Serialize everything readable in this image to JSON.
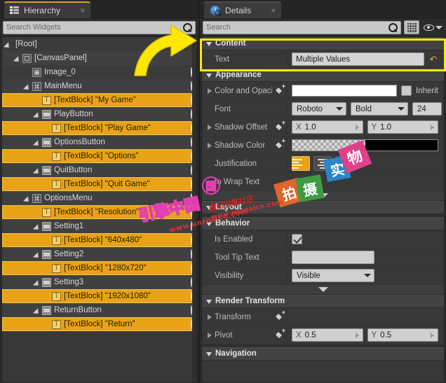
{
  "hierarchy_panel": {
    "tab": {
      "label": "Hierarchy",
      "icon": "list-icon",
      "close": "×"
    },
    "search": {
      "placeholder": "Search Widgets",
      "icon": "search-icon"
    },
    "tree": [
      {
        "label": "[Root]",
        "depth": 0,
        "icon": "none",
        "selected": false,
        "expander": "open",
        "eye": false
      },
      {
        "label": "[CanvasPanel]",
        "depth": 1,
        "icon": "panel",
        "selected": false,
        "expander": "open",
        "eye": false
      },
      {
        "label": "Image_0",
        "depth": 2,
        "icon": "image",
        "selected": false,
        "expander": "none",
        "eye": true
      },
      {
        "label": "MainMenu",
        "depth": 2,
        "icon": "vbox",
        "selected": false,
        "expander": "open",
        "eye": true
      },
      {
        "label": "[TextBlock] \"My Game\"",
        "depth": 3,
        "icon": "text",
        "selected": true,
        "expander": "none",
        "eye": true
      },
      {
        "label": "PlayButton",
        "depth": 3,
        "icon": "button",
        "selected": false,
        "expander": "open",
        "eye": true
      },
      {
        "label": "[TextBlock] \"Play Game\"",
        "depth": 4,
        "icon": "text",
        "selected": true,
        "expander": "none",
        "eye": true
      },
      {
        "label": "OptionsButton",
        "depth": 3,
        "icon": "button",
        "selected": false,
        "expander": "open",
        "eye": true
      },
      {
        "label": "[TextBlock] \"Options\"",
        "depth": 4,
        "icon": "text",
        "selected": true,
        "expander": "none",
        "eye": true
      },
      {
        "label": "QuitButton",
        "depth": 3,
        "icon": "button",
        "selected": false,
        "expander": "open",
        "eye": true
      },
      {
        "label": "[TextBlock] \"Quit Game\"",
        "depth": 4,
        "icon": "text",
        "selected": true,
        "expander": "none",
        "eye": true
      },
      {
        "label": "OptionsMenu",
        "depth": 2,
        "icon": "vbox",
        "selected": false,
        "expander": "open",
        "eye": true
      },
      {
        "label": "[TextBlock] \"Resolution\"",
        "depth": 3,
        "icon": "text",
        "selected": true,
        "expander": "none",
        "eye": true
      },
      {
        "label": "Setting1",
        "depth": 3,
        "icon": "button",
        "selected": false,
        "expander": "open",
        "eye": true
      },
      {
        "label": "[TextBlock] \"640x480\"",
        "depth": 4,
        "icon": "text",
        "selected": true,
        "expander": "none",
        "eye": true
      },
      {
        "label": "Setting2",
        "depth": 3,
        "icon": "button",
        "selected": false,
        "expander": "open",
        "eye": true
      },
      {
        "label": "[TextBlock] \"1280x720\"",
        "depth": 4,
        "icon": "text",
        "selected": true,
        "expander": "none",
        "eye": true
      },
      {
        "label": "Setting3",
        "depth": 3,
        "icon": "button",
        "selected": false,
        "expander": "open",
        "eye": true
      },
      {
        "label": "[TextBlock] \"1920x1080\"",
        "depth": 4,
        "icon": "text",
        "selected": true,
        "expander": "none",
        "eye": true
      },
      {
        "label": "ReturnButton",
        "depth": 3,
        "icon": "button",
        "selected": false,
        "expander": "open",
        "eye": true
      },
      {
        "label": "[TextBlock] \"Return\"",
        "depth": 4,
        "icon": "text",
        "selected": true,
        "expander": "none",
        "eye": true
      }
    ]
  },
  "details_panel": {
    "tab": {
      "label": "Details",
      "icon": "info-magnifier-icon",
      "close": "×"
    },
    "search": {
      "placeholder": "Search",
      "icon": "search-icon"
    },
    "toolbar": {
      "grid_icon": "grid-view-icon",
      "eye_icon": "eye-icon",
      "caret_icon": "chevron-down-icon"
    },
    "sections": {
      "content": {
        "title": "Content",
        "text_label": "Text",
        "text_value": "Multiple Values",
        "revert_icon": "revert-arrow-icon"
      },
      "appearance": {
        "title": "Appearance",
        "color_and_opacity_label": "Color and Opaci",
        "color_value_hex": "#ffffff",
        "inherit_label": "Inherit",
        "inherit_checked": false,
        "font_label": "Font",
        "font_family": "Roboto",
        "font_style": "Bold",
        "font_size": "24",
        "shadow_offset_label": "Shadow Offset",
        "shadow_offset_x_axis": "X",
        "shadow_offset_x": "1.0",
        "shadow_offset_y_axis": "Y",
        "shadow_offset_y": "1.0",
        "shadow_color_label": "Shadow Color",
        "shadow_color_hex": "#000000",
        "justification_label": "Justification",
        "justification_options": [
          "Align Left",
          "Align Center",
          "Align Right"
        ],
        "justification_selected": "Align Left",
        "auto_wrap_text_label": "to Wrap Text"
      },
      "layout": {
        "title": "Layout"
      },
      "behavior": {
        "title": "Behavior",
        "is_enabled_label": "Is Enabled",
        "is_enabled_checked": true,
        "tool_tip_text_label": "Tool Tip Text",
        "tool_tip_text_value": "",
        "visibility_label": "Visibility",
        "visibility_value": "Visible"
      },
      "render_transform": {
        "title": "Render Transform",
        "transform_label": "Transform",
        "pivot_label": "Pivot",
        "pivot_x_axis": "X",
        "pivot_x": "0.5",
        "pivot_y_axis": "Y",
        "pivot_y": "0.5"
      },
      "navigation": {
        "title": "Navigation"
      }
    }
  },
  "annotations": {
    "highlight_box_color": "#ffe800",
    "arrow_color": "#ffe800",
    "arrow_name": "yellow-pointer-arrow"
  },
  "watermarks": {
    "shi": "实",
    "wu": "物",
    "pai": "拍",
    "she": "摄",
    "cn_engine": "引擎中国",
    "url": "www.unrealcn.com",
    "tagline": "虚幻引擎社区"
  }
}
